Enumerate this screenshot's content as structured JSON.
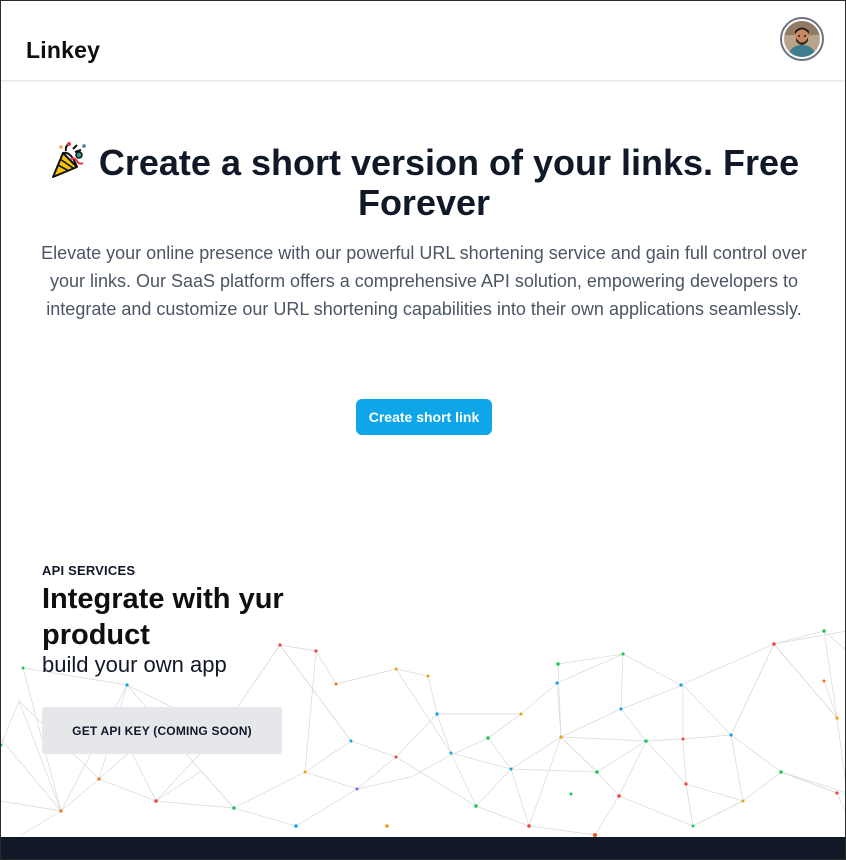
{
  "navbar": {
    "brand": "Linkey",
    "avatar_icon": "user-avatar"
  },
  "hero": {
    "icon": "party-popper-icon",
    "title": "Create a short version of your links. Free Forever",
    "description": "Elevate your online presence with our powerful URL shortening service and gain full control over your links. Our SaaS platform offers a comprehensive API solution, empowering developers to integrate and customize our URL shortening capabilities into their own applications seamlessly.",
    "cta_label": "Create short link"
  },
  "api_section": {
    "eyebrow": "API SERVICES",
    "title": "Integrate with yur product",
    "subtitle": "build your own app",
    "button_label": "GET API KEY (COMING SOON)"
  },
  "colors": {
    "accent": "#0ea5e9",
    "footer": "#111827",
    "button_gray": "#e5e7eb"
  }
}
